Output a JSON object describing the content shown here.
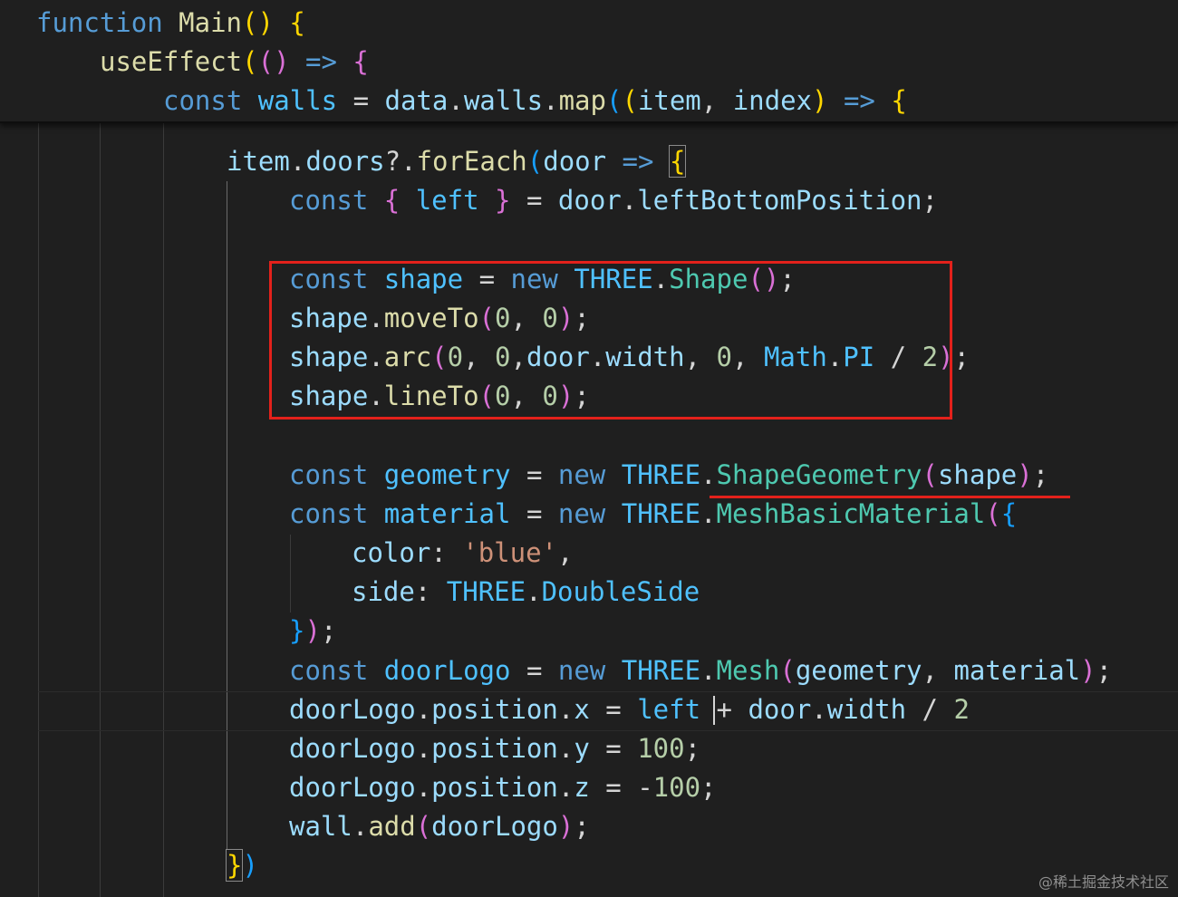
{
  "editor": {
    "sticky_scroll": {
      "line1": {
        "kw": "function",
        "fn": "Main",
        "paren": "()",
        "brace": "{"
      },
      "line2": {
        "fn": "useEffect",
        "paren_open": "(",
        "inner_parens": "()",
        "arrow": "=>",
        "brace": "{"
      },
      "line3": {
        "kw": "const",
        "var": "walls",
        "eq": "=",
        "obj": "data",
        "dot1": ".",
        "prop": "walls",
        "dot2": ".",
        "fn": "map",
        "p1": "(",
        "p2": "(",
        "arg1": "item",
        "comma": ",",
        "arg2": "index",
        "p3": ")",
        "arrow": "=>",
        "brace": "{"
      }
    },
    "code": {
      "l1": {
        "obj": "item",
        "dot": ".",
        "prop": "doors",
        "opt": "?.",
        "fn": "forEach",
        "paren": "(",
        "arg": "door",
        "arrow": "=>",
        "brace": "{"
      },
      "l2": {
        "kw": "const",
        "lb": "{",
        "var": "left",
        "rb": "}",
        "eq": "=",
        "obj": "door",
        "dot": ".",
        "prop": "leftBottomPosition",
        "semi": ";"
      },
      "l3": {
        "kw": "const",
        "var": "shape",
        "eq": "=",
        "new": "new",
        "ns": "THREE",
        "dot": ".",
        "cls": "Shape",
        "paren": "()",
        "semi": ";"
      },
      "l4": {
        "obj": "shape",
        "dot": ".",
        "fn": "moveTo",
        "po": "(",
        "n1": "0",
        "c1": ",",
        "n2": "0",
        "pc": ")",
        "semi": ";"
      },
      "l5": {
        "obj": "shape",
        "dot": ".",
        "fn": "arc",
        "po": "(",
        "n1": "0",
        "c1": ",",
        "n2": "0",
        "c2": ",",
        "obj2": "door",
        "dot2": ".",
        "prop": "width",
        "c3": ",",
        "n3": "0",
        "c4": ",",
        "math": "Math",
        "dot3": ".",
        "pi": "PI",
        "div": "/",
        "n4": "2",
        "pc": ")",
        "semi": ";"
      },
      "l6": {
        "obj": "shape",
        "dot": ".",
        "fn": "lineTo",
        "po": "(",
        "n1": "0",
        "c1": ",",
        "n2": "0",
        "pc": ")",
        "semi": ";"
      },
      "l7": {
        "kw": "const",
        "var": "geometry",
        "eq": "=",
        "new": "new",
        "ns": "THREE",
        "dot": ".",
        "cls": "ShapeGeometry",
        "po": "(",
        "arg": "shape",
        "pc": ")",
        "semi": ";"
      },
      "l8": {
        "kw": "const",
        "var": "material",
        "eq": "=",
        "new": "new",
        "ns": "THREE",
        "dot": ".",
        "cls": "MeshBasicMaterial",
        "po": "(",
        "brace": "{"
      },
      "l9": {
        "prop": "color",
        "colon": ":",
        "str": "'blue'",
        "comma": ","
      },
      "l10": {
        "prop": "side",
        "colon": ":",
        "ns": "THREE",
        "dot": ".",
        "val": "DoubleSide"
      },
      "l11": {
        "rb": "}",
        "pc": ")",
        "semi": ";"
      },
      "l12": {
        "kw": "const",
        "var": "doorLogo",
        "eq": "=",
        "new": "new",
        "ns": "THREE",
        "dot": ".",
        "cls": "Mesh",
        "po": "(",
        "a1": "geometry",
        "c1": ",",
        "a2": "material",
        "pc": ")",
        "semi": ";"
      },
      "l13": {
        "obj": "doorLogo",
        "dot": ".",
        "prop": "position",
        "dot2": ".",
        "axis": "x",
        "eq": "=",
        "var": "left",
        "plus": "+",
        "obj2": "door",
        "dot3": ".",
        "prop2": "width",
        "div": "/",
        "n": "2"
      },
      "l14": {
        "obj": "doorLogo",
        "dot": ".",
        "prop": "position",
        "dot2": ".",
        "axis": "y",
        "eq": "=",
        "n": "100",
        "semi": ";"
      },
      "l15": {
        "obj": "doorLogo",
        "dot": ".",
        "prop": "position",
        "dot2": ".",
        "axis": "z",
        "eq": "=",
        "minus": "-",
        "n": "100",
        "semi": ";"
      },
      "l16": {
        "obj": "wall",
        "dot": ".",
        "fn": "add",
        "po": "(",
        "arg": "doorLogo",
        "pc": ")",
        "semi": ";"
      },
      "l17": {
        "rb": "}",
        "pc": ")"
      }
    }
  },
  "colors": {
    "annotation": "#e3211b",
    "background": "#1f1f1f"
  },
  "watermark": "@稀土掘金技术社区"
}
